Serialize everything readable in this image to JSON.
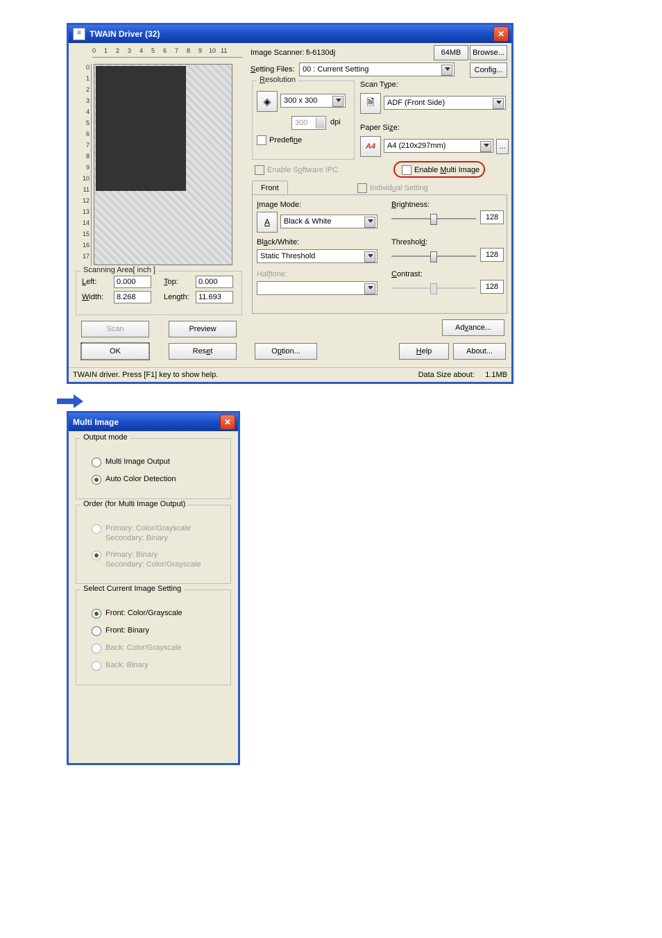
{
  "twain": {
    "title": "TWAIN Driver (32)",
    "hruler": [
      "0",
      "1",
      "2",
      "3",
      "4",
      "5",
      "6",
      "7",
      "8",
      "9",
      "10",
      "11"
    ],
    "vruler": [
      "0",
      "1",
      "2",
      "3",
      "4",
      "5",
      "6",
      "7",
      "8",
      "9",
      "10",
      "11",
      "12",
      "13",
      "14",
      "15",
      "16",
      "17"
    ],
    "scanning_area": {
      "title": "Scanning Area[ inch ]",
      "left_label": "Left:",
      "left_value": "0.000",
      "top_label": "Top:",
      "top_value": "0.000",
      "width_label": "Width:",
      "width_value": "8.268",
      "length_label": "Length:",
      "length_value": "11.693"
    },
    "buttons": {
      "scan": "Scan",
      "preview": "Preview",
      "ok": "OK",
      "reset": "Reset",
      "option": "Option...",
      "help": "Help",
      "about": "About...",
      "advance": "Advance...",
      "browse": "Browse...",
      "config": "Config...",
      "paper_more": "..."
    },
    "image_scanner_label": "Image Scanner:",
    "image_scanner_value": "fi-6130dj",
    "memory": "64MB",
    "setting_files_label": "Setting Files:",
    "setting_files_value": "00 : Current Setting",
    "resolution": {
      "title": "Resolution",
      "value": "300 x 300",
      "dpi_value": "300",
      "dpi_label": "dpi",
      "predefine": "Predefine"
    },
    "scan_type_label": "Scan Type:",
    "scan_type_value": "ADF (Front Side)",
    "paper_size_label": "Paper Size:",
    "paper_size_value": "A4 (210x297mm)",
    "paper_icon": "A4",
    "enable_ipc": "Enable Software IPC",
    "enable_multi": "Enable Multi Image",
    "front_tab": "Front",
    "individual_setting": "Individual Setting",
    "image_mode_label": "Image Mode:",
    "image_mode_value": "Black & White",
    "bw_label": "Black/White:",
    "bw_value": "Static Threshold",
    "halftone_label": "Halftone:",
    "brightness_label": "Brightness:",
    "brightness_value": "128",
    "threshold_label": "Threshold:",
    "threshold_value": "128",
    "contrast_label": "Contrast:",
    "contrast_value": "128",
    "status_left": "TWAIN driver. Press [F1] key to show help.",
    "status_right_label": "Data Size about:",
    "status_right_value": "1.1MB"
  },
  "multi": {
    "title": "Multi Image",
    "output_mode": {
      "legend": "Output mode",
      "opt1": "Multi Image Output",
      "opt2": "Auto Color Detection"
    },
    "order": {
      "legend": "Order (for Multi Image Output)",
      "opt1_l1": "Primary: Color/Grayscale",
      "opt1_l2": "Secondary: Binary",
      "opt2_l1": "Primary: Binary",
      "opt2_l2": "Secondary: Color/Grayscale"
    },
    "select": {
      "legend": "Select Current Image Setting",
      "opt1": "Front: Color/Grayscale",
      "opt2": "Front: Binary",
      "opt3": "Back: Color/Grayscale",
      "opt4": "Back: Binary"
    }
  }
}
